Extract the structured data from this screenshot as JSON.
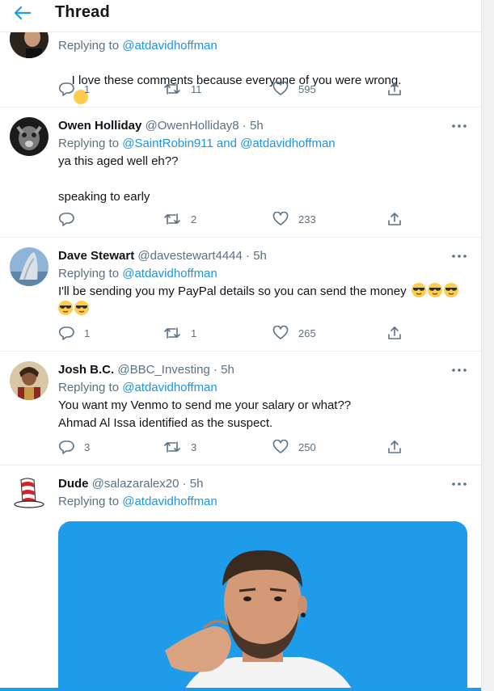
{
  "header": {
    "title": "Thread"
  },
  "tweets": [
    {
      "replying_prefix": "Replying to ",
      "replying_to": "@atdavidhoffman",
      "text": "I love these comments because everyone of you were wrong.",
      "emoji": "smiling-face-emoji",
      "replies": "1",
      "retweets": "11",
      "likes": "595"
    },
    {
      "name": "Owen Holliday",
      "handle": "@OwenHolliday8 · 5h",
      "replying_prefix": "Replying to ",
      "replying_to": "@SaintRobin911 and @atdavidhoffman",
      "text": "ya this aged well eh??\n\nspeaking to early",
      "replies": "",
      "retweets": "2",
      "likes": "233"
    },
    {
      "name": "Dave Stewart",
      "handle": "@davestewart4444 · 5h",
      "replying_prefix": "Replying to ",
      "replying_to": "@atdavidhoffman",
      "text": "I'll be sending you my PayPal details so you can send the money",
      "emoji": "sunglasses-emoji",
      "replies": "1",
      "retweets": "1",
      "likes": "265"
    },
    {
      "name": "Josh B.C.",
      "handle": "@BBC_Investing · 5h",
      "replying_prefix": "Replying to ",
      "replying_to": "@atdavidhoffman",
      "text": "You want my Venmo to send me your salary or what??\nAhmad Al Issa identified as the suspect.",
      "replies": "3",
      "retweets": "3",
      "likes": "250"
    },
    {
      "name": "Dude",
      "handle": "@salazaralex20 · 5h",
      "replying_prefix": "Replying to ",
      "replying_to": "@atdavidhoffman"
    }
  ],
  "colors": {
    "accent": "#1d9bf0",
    "mention": "#1b95e0",
    "secondary": "#5b7083",
    "media_bg": "#1e9be9"
  }
}
